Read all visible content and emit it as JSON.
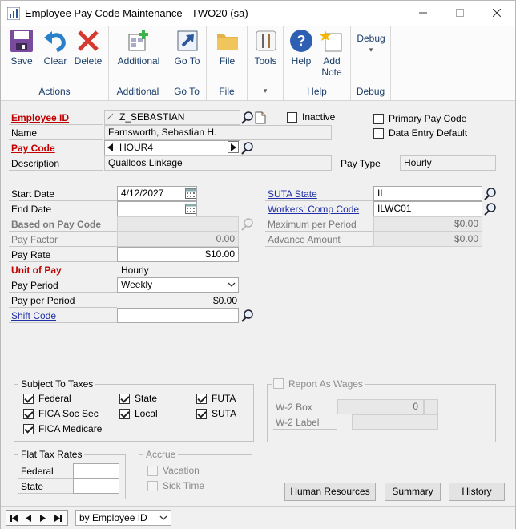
{
  "window": {
    "title": "Employee Pay Code Maintenance  -  TWO20 (sa)"
  },
  "ribbon": {
    "groups": [
      {
        "label": "Actions",
        "buttons": [
          "Save",
          "Clear",
          "Delete"
        ]
      },
      {
        "label": "Additional",
        "buttons": [
          "Additional"
        ]
      },
      {
        "label": "Go To",
        "buttons": [
          "Go To"
        ]
      },
      {
        "label": "File",
        "buttons": [
          "File"
        ]
      },
      {
        "label": "",
        "buttons": [
          "Tools"
        ]
      },
      {
        "label": "Help",
        "buttons": [
          "Help",
          "Add",
          "Note"
        ]
      },
      {
        "label": "Debug",
        "buttons": [
          "Debug"
        ]
      }
    ],
    "save": "Save",
    "clear": "Clear",
    "delete": "Delete",
    "additional": "Additional",
    "additional_group": "Additional",
    "goto": "Go To",
    "goto_group": "Go To",
    "file": "File",
    "file_group": "File",
    "tools": "Tools",
    "help": "Help",
    "add_note_1": "Add",
    "add_note_2": "Note",
    "help_group": "Help",
    "debug": "Debug",
    "debug_group": "Debug",
    "actions_group": "Actions"
  },
  "form": {
    "employee_id_label": "Employee ID",
    "employee_id_value": "Z_SEBASTIAN",
    "inactive_label": "Inactive",
    "inactive_checked": false,
    "primary_pay_code_label": "Primary Pay Code",
    "primary_pay_code_checked": false,
    "data_entry_default_label": "Data Entry Default",
    "data_entry_default_checked": false,
    "name_label": "Name",
    "name_value": "Farnsworth, Sebastian H.",
    "pay_code_label": "Pay Code",
    "pay_code_value": "HOUR4",
    "description_label": "Description",
    "description_value": "Qualloos Linkage",
    "pay_type_label": "Pay Type",
    "pay_type_value": "Hourly",
    "start_date_label": "Start Date",
    "start_date_value": "4/12/2027",
    "end_date_label": "End Date",
    "end_date_value": "",
    "based_on_label": "Based on Pay Code",
    "based_on_value": "",
    "pay_factor_label": "Pay Factor",
    "pay_factor_value": "0.00",
    "pay_rate_label": "Pay Rate",
    "pay_rate_value": "$10.00",
    "unit_of_pay_label": "Unit of Pay",
    "unit_of_pay_value": "Hourly",
    "pay_period_label": "Pay Period",
    "pay_period_value": "Weekly",
    "pay_per_period_label": "Pay per Period",
    "pay_per_period_value": "$0.00",
    "shift_code_label": "Shift Code",
    "shift_code_value": "",
    "suta_state_label": "SUTA State",
    "suta_state_value": "IL",
    "workers_comp_label": "Workers' Comp Code",
    "workers_comp_value": "ILWC01",
    "max_per_period_label": "Maximum per Period",
    "max_per_period_value": "$0.00",
    "advance_amount_label": "Advance Amount",
    "advance_amount_value": "$0.00"
  },
  "taxes": {
    "title": "Subject To Taxes",
    "federal": "Federal",
    "fica_soc_sec": "FICA Soc Sec",
    "fica_medicare": "FICA Medicare",
    "state": "State",
    "local": "Local",
    "futa": "FUTA",
    "suta": "SUTA"
  },
  "wages": {
    "report_as_wages": "Report As Wages",
    "w2_box_label": "W-2 Box",
    "w2_box_value": "0",
    "w2_label_label": "W-2 Label"
  },
  "flat_tax": {
    "title": "Flat Tax Rates",
    "federal": "Federal",
    "state": "State"
  },
  "accrue": {
    "title": "Accrue",
    "vacation": "Vacation",
    "sick_time": "Sick Time"
  },
  "buttons": {
    "human_resources": "Human Resources",
    "summary": "Summary",
    "history": "History"
  },
  "statusbar": {
    "sort_value": "by Employee ID"
  },
  "colors": {
    "required_label": "#c00000",
    "link_label": "#1f2fa8",
    "ribbon_text": "#1a3e6b"
  }
}
